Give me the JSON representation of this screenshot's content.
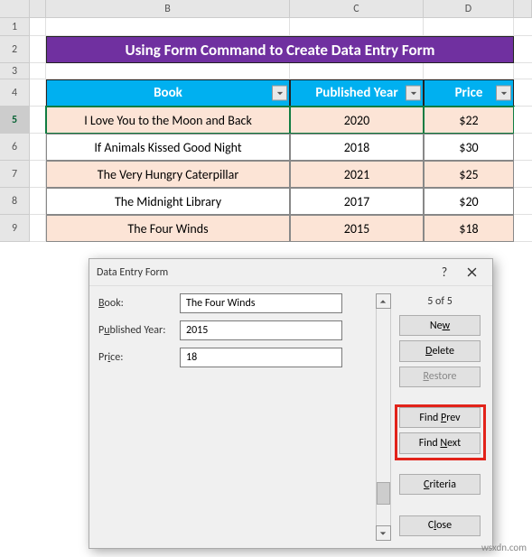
{
  "columns": {
    "A": "A",
    "B": "B",
    "C": "C",
    "D": "D"
  },
  "row_numbers": [
    "1",
    "2",
    "3",
    "4",
    "5",
    "6",
    "7",
    "8",
    "9"
  ],
  "title": "Using Form Command to Create Data Entry Form",
  "headers": {
    "book": "Book",
    "year": "Published Year",
    "price": "Price"
  },
  "table": [
    {
      "book": "I Love You to the Moon and Back",
      "year": "2020",
      "price": "$22"
    },
    {
      "book": "If Animals Kissed Good Night",
      "year": "2018",
      "price": "$30"
    },
    {
      "book": "The Very Hungry Caterpillar",
      "year": "2021",
      "price": "$25"
    },
    {
      "book": "The Midnight Library",
      "year": "2017",
      "price": "$20"
    },
    {
      "book": "The Four Winds",
      "year": "2015",
      "price": "$18"
    }
  ],
  "dialog": {
    "title": "Data Entry Form",
    "help": "?",
    "labels": {
      "book": "Book:",
      "year": "Published Year:",
      "price": "Price:"
    },
    "values": {
      "book": "The Four Winds",
      "year": "2015",
      "price": "18"
    },
    "counter": "5 of 5",
    "buttons": {
      "new": "New",
      "delete": "Delete",
      "restore": "Restore",
      "find_prev": "Find Prev",
      "find_next": "Find Next",
      "criteria": "Criteria",
      "close": "Close"
    }
  },
  "watermark": "wsxdn.com"
}
